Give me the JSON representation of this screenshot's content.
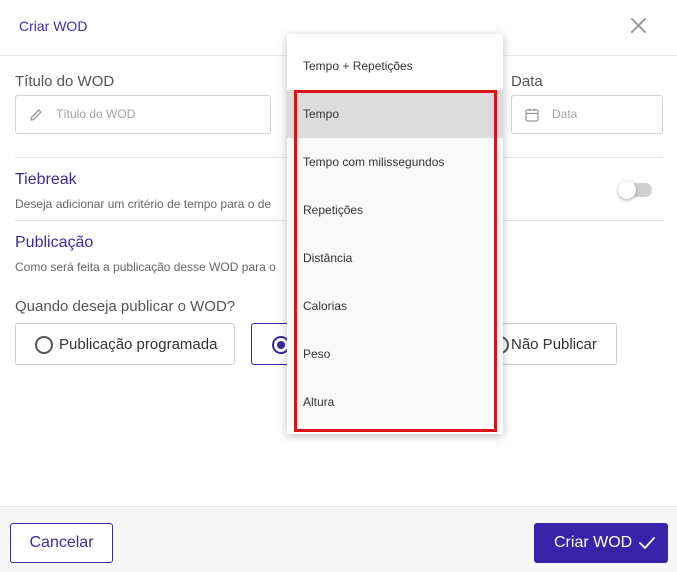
{
  "header": {
    "title": "Criar WOD"
  },
  "form": {
    "title_label": "Título do WOD",
    "title_placeholder": "Título do WOD",
    "date_label": "Data",
    "date_placeholder": "Data"
  },
  "tiebreak": {
    "title": "Tiebreak",
    "description": "Deseja adicionar um critério de tempo para o de"
  },
  "publicacao": {
    "title": "Publicação",
    "description": "Como será feita a publicação desse WOD para o",
    "question": "Quando deseja publicar o WOD?",
    "options": [
      {
        "label": "Publicação programada",
        "checked": false
      },
      {
        "label": "",
        "checked": true
      },
      {
        "label": "Não Publicar",
        "checked": false
      }
    ]
  },
  "dropdown": {
    "items": [
      "Tempo + Repetições",
      "Tempo",
      "Tempo com milissegundos",
      "Repetições",
      "Distância",
      "Calorias",
      "Peso",
      "Altura"
    ],
    "selected": "Tempo"
  },
  "footer": {
    "cancel_label": "Cancelar",
    "submit_label": "Criar WOD"
  },
  "colors": {
    "accent": "#3b2b9e",
    "primary_button": "#3822a8",
    "highlight": "#e0101a"
  }
}
